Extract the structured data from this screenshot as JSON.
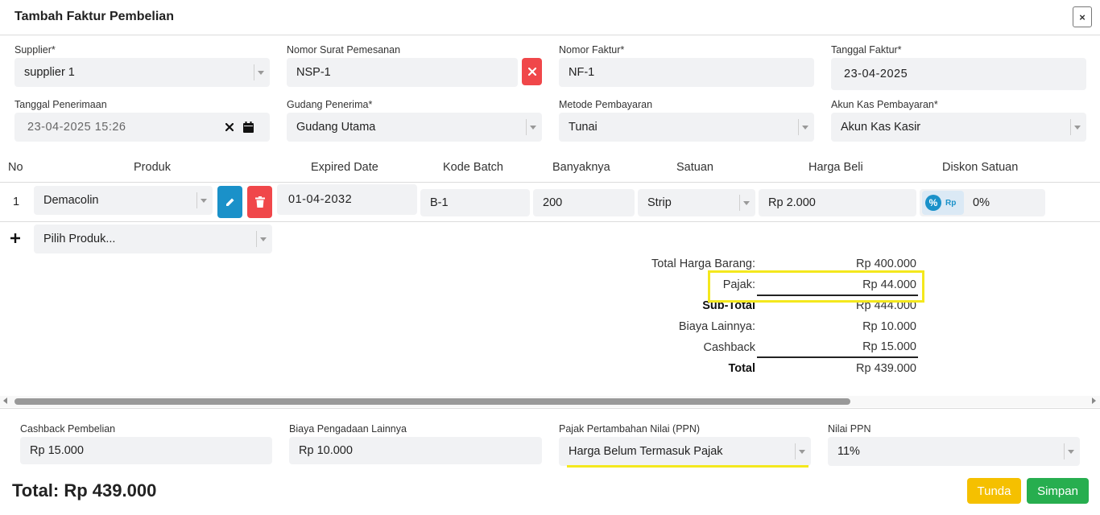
{
  "header": {
    "title": "Tambah Faktur Pembelian",
    "close_icon": "×"
  },
  "form": {
    "supplier": {
      "label": "Supplier*",
      "value": "supplier 1"
    },
    "nomor_surat": {
      "label": "Nomor Surat Pemesanan",
      "value": "NSP-1"
    },
    "nomor_faktur": {
      "label": "Nomor Faktur*",
      "value": "NF-1"
    },
    "tanggal_faktur": {
      "label": "Tanggal Faktur*",
      "value": "23-04-2025"
    },
    "tanggal_penerimaan": {
      "label": "Tanggal Penerimaan",
      "value": "23-04-2025 15:26"
    },
    "gudang": {
      "label": "Gudang Penerima*",
      "value": "Gudang Utama"
    },
    "metode": {
      "label": "Metode Pembayaran",
      "value": "Tunai"
    },
    "akun_kas": {
      "label": "Akun Kas Pembayaran*",
      "value": "Akun Kas Kasir"
    }
  },
  "table": {
    "headers": [
      "No",
      "Produk",
      "Expired Date",
      "Kode Batch",
      "Banyaknya",
      "Satuan",
      "Harga Beli",
      "Diskon Satuan"
    ],
    "rows": [
      {
        "no": "1",
        "produk": "Demacolin",
        "expired": "01-04-2032",
        "batch": "B-1",
        "qty": "200",
        "satuan": "Strip",
        "harga": "Rp 2.000",
        "diskon_mode": "Rp",
        "diskon": "0%"
      }
    ],
    "add_placeholder": "Pilih Produk..."
  },
  "summary": {
    "total_harga_label": "Total Harga Barang:",
    "total_harga": "Rp 400.000",
    "pajak_label": "Pajak:",
    "pajak": "Rp 44.000",
    "subtotal_label": "Sub-Total",
    "subtotal": "Rp 444.000",
    "biaya_label": "Biaya Lainnya:",
    "biaya": "Rp 10.000",
    "cashback_label": "Cashback",
    "cashback": "Rp 15.000",
    "total_label": "Total",
    "total": "Rp 439.000"
  },
  "footer": {
    "cashback": {
      "label": "Cashback Pembelian",
      "value": "Rp 15.000"
    },
    "biaya": {
      "label": "Biaya Pengadaan Lainnya",
      "value": "Rp 10.000"
    },
    "ppn": {
      "label": "Pajak Pertambahan Nilai (PPN)",
      "value": "Harga Belum Termasuk Pajak"
    },
    "nilai_ppn": {
      "label": "Nilai PPN",
      "value": "11%"
    },
    "total_text": "Total: Rp 439.000",
    "tunda": "Tunda",
    "simpan": "Simpan"
  },
  "colors": {
    "tunda": "#f5c000",
    "simpan": "#27ae4f",
    "danger": "#f0474a",
    "primary": "#1a91c9",
    "highlight": "#f4e81d"
  }
}
